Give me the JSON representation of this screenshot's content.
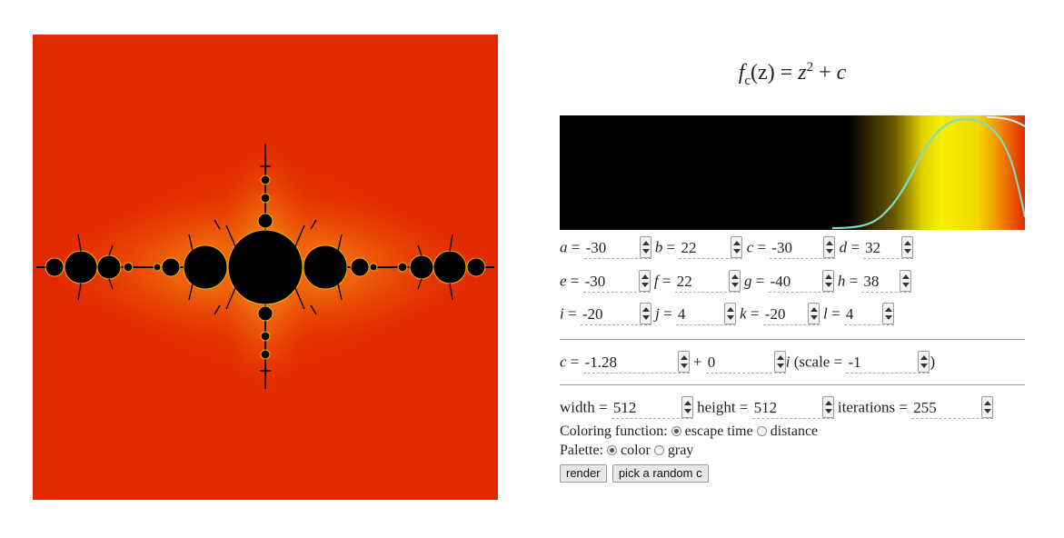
{
  "formula": {
    "f": "f",
    "sub": "c",
    "arg": "(z)",
    "eq": " = ",
    "z": "z",
    "sup": "2",
    "plus": " + ",
    "c": "c"
  },
  "coefficients": [
    {
      "name": "a",
      "value": "-30"
    },
    {
      "name": "b",
      "value": "22"
    },
    {
      "name": "c",
      "value": "-30"
    },
    {
      "name": "d",
      "value": "32"
    },
    {
      "name": "e",
      "value": "-30"
    },
    {
      "name": "f",
      "value": "22"
    },
    {
      "name": "g",
      "value": "-40"
    },
    {
      "name": "h",
      "value": "38"
    },
    {
      "name": "i",
      "value": "-20"
    },
    {
      "name": "j",
      "value": "4"
    },
    {
      "name": "k",
      "value": "-20"
    },
    {
      "name": "l",
      "value": "4"
    }
  ],
  "c_param": {
    "label": "c",
    "real": "-1.28",
    "plus": "+",
    "imag": "0",
    "imag_unit": "i",
    "scale_open": "(scale =",
    "scale": "-1",
    "scale_close": ")"
  },
  "render_settings": {
    "width_label": "width =",
    "width": "512",
    "height_label": "height =",
    "height": "512",
    "iterations_label": "iterations =",
    "iterations": "255"
  },
  "coloring": {
    "label": "Coloring function:",
    "options": [
      "escape time",
      "distance"
    ],
    "selected": "escape time"
  },
  "palette": {
    "label": "Palette:",
    "options": [
      "color",
      "gray"
    ],
    "selected": "color"
  },
  "buttons": {
    "render": "render",
    "random": "pick a random c"
  },
  "colors": {
    "background_fractal": "#e22a00",
    "set": "#000000",
    "accent_yellow": "#f4ef00",
    "curve": "#7fdcc4"
  }
}
